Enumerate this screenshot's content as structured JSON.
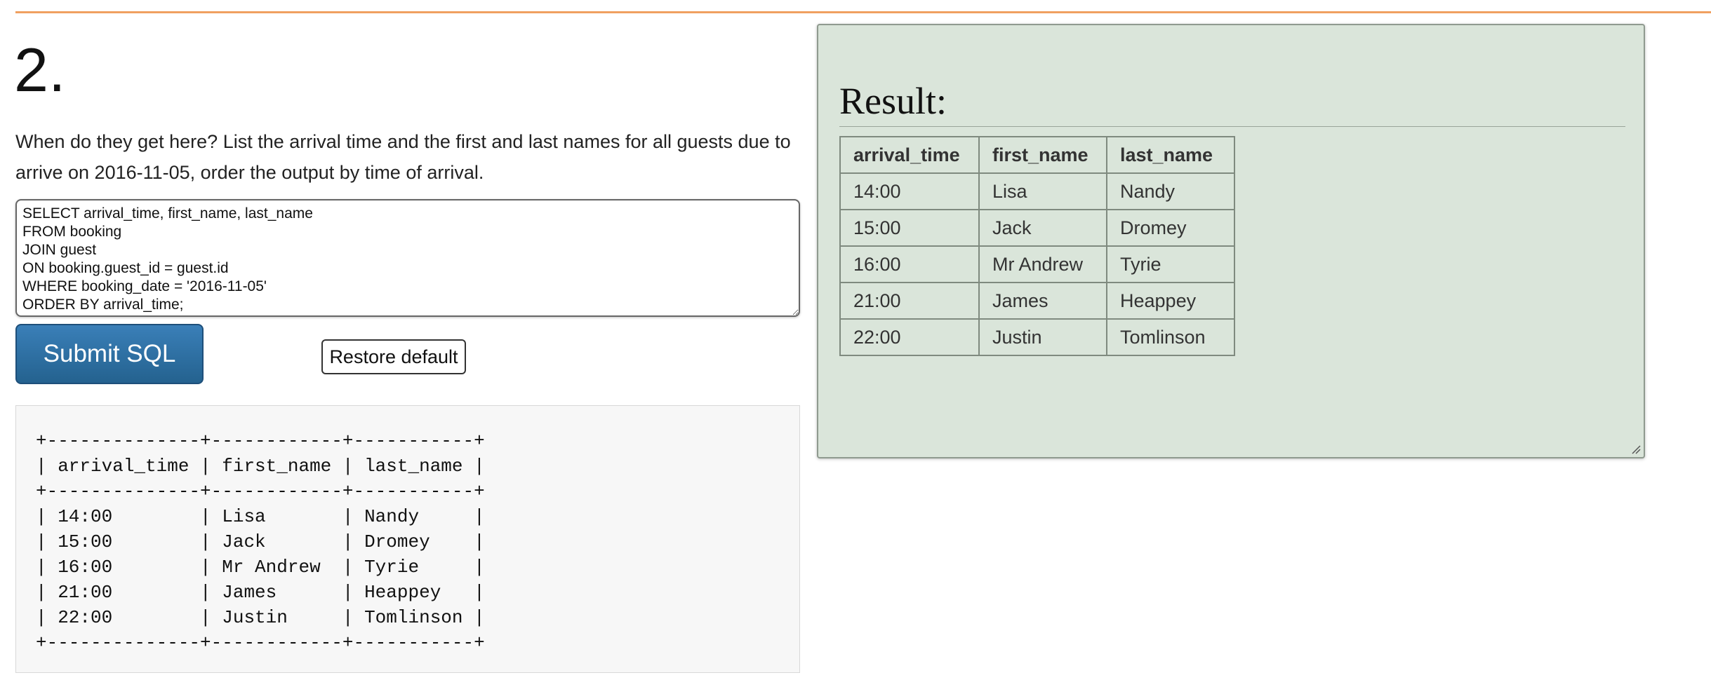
{
  "question": {
    "number": "2.",
    "text": "When do they get here? List the arrival time and the first and last names for all guests due to arrive on 2016-11-05, order the output by time of arrival."
  },
  "editor": {
    "sql": "SELECT arrival_time, first_name, last_name\nFROM booking\nJOIN guest\nON booking.guest_id = guest.id\nWHERE booking_date = '2016-11-05'\nORDER BY arrival_time;"
  },
  "buttons": {
    "submit_label": "Submit SQL",
    "restore_label": "Restore default"
  },
  "text_output": "+--------------+------------+-----------+\n| arrival_time | first_name | last_name |\n+--------------+------------+-----------+\n| 14:00        | Lisa       | Nandy     |\n| 15:00        | Jack       | Dromey    |\n| 16:00        | Mr Andrew  | Tyrie     |\n| 21:00        | James      | Heappey   |\n| 22:00        | Justin     | Tomlinson |\n+--------------+------------+-----------+",
  "result": {
    "heading": "Result:",
    "columns": [
      "arrival_time",
      "first_name",
      "last_name"
    ],
    "rows": [
      [
        "14:00",
        "Lisa",
        "Nandy"
      ],
      [
        "15:00",
        "Jack",
        "Dromey"
      ],
      [
        "16:00",
        "Mr Andrew",
        "Tyrie"
      ],
      [
        "21:00",
        "James",
        "Heappey"
      ],
      [
        "22:00",
        "Justin",
        "Tomlinson"
      ]
    ]
  },
  "colors": {
    "accent_rule": "#f0a060",
    "submit_button": "#2c6ca0",
    "result_panel": "#dae5da"
  },
  "icons": {
    "resize_handle": "resize-grip-icon"
  }
}
